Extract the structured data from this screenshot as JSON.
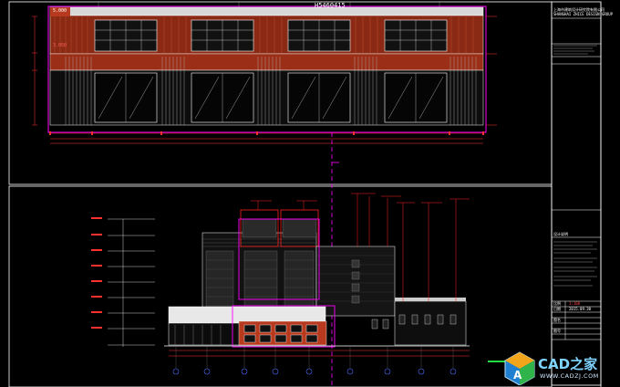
{
  "drawing": {
    "code": "H5460415",
    "elev_top": "5.000",
    "elev_mid": "3.050",
    "scale": "1:100",
    "date": "2015.09.30"
  },
  "title_block": {
    "company_cn": "上海市建筑设计研究院有限公司",
    "company_en": "SHANGHAI ZHICE DESIGN GROUP",
    "notes_head": "设计说明",
    "row_scale": "比例",
    "row_date": "日期",
    "row_drawing": "图名",
    "row_no": "图号"
  },
  "watermark": {
    "brand": "CAD之家",
    "url": "WWW.CADZJ.COM"
  },
  "colors": {
    "frame": "#ffffff",
    "magenta": "#ff00ff",
    "red": "#ff2020",
    "brick": "#b83a1e",
    "dim": "#e03030",
    "green": "#22dd44"
  }
}
